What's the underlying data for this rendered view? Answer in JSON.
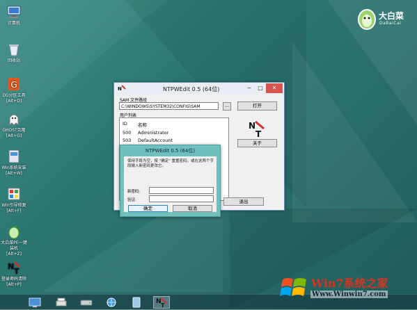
{
  "desktop": {
    "icons": [
      {
        "label": "计算机",
        "sub": "",
        "icon": "computer-icon"
      },
      {
        "label": "回收站",
        "sub": "",
        "icon": "recycle-bin-icon"
      },
      {
        "label": "DG分区工具",
        "sub": "[Alt+D]",
        "icon": "dg-partition-icon"
      },
      {
        "label": "GHOST克隆",
        "sub": "[Alt+G]",
        "icon": "ghost-icon"
      },
      {
        "label": "Win系统安装",
        "sub": "[Alt+W]",
        "icon": "win-install-icon"
      },
      {
        "label": "Win引导修复",
        "sub": "[Alt+F]",
        "icon": "boot-repair-icon"
      },
      {
        "label": "大白菜PE一键装机",
        "sub": "[Alt+Z]",
        "icon": "onekey-install-icon"
      },
      {
        "label": "登录密码清除",
        "sub": "[Alt+P]",
        "icon": "password-clear-icon"
      }
    ]
  },
  "logo": {
    "title": "大白菜",
    "subtitle": "DaBaiCai"
  },
  "main_window": {
    "title": "NTPWEdit 0.5 (64位)",
    "sam_label": "SAM 文件路径",
    "sam_path": "C:\\WINDOWS\\SYSTEM32\\CONFIG\\SAM",
    "browse_label": "...",
    "open_label": "打开",
    "users_label": "用户列表",
    "columns": [
      "ID",
      "名称"
    ],
    "rows": [
      {
        "id": "500",
        "name": "Administrator"
      },
      {
        "id": "503",
        "name": "DefaultAccount"
      }
    ],
    "about_label": "关于",
    "exit_label": "退出",
    "minimize": "−",
    "maximize": "□",
    "close": "✕"
  },
  "dialog": {
    "title": "NTPWEdit 0.5 (64位)",
    "message": "保持字段为空，按 \"确定\" 重置密码。或在这两个字段输入新密码更改它。",
    "new_password_label": "新密码:",
    "verify_label": "验证:",
    "new_password_value": "",
    "verify_value": "",
    "ok_label": "确定",
    "cancel_label": "取消"
  },
  "watermark": {
    "title": "Win7系统之家",
    "subtitle": "Www.Winwin7.com"
  },
  "colors": {
    "accent": "#6fc0bd",
    "brand_red": "#d9341f"
  }
}
